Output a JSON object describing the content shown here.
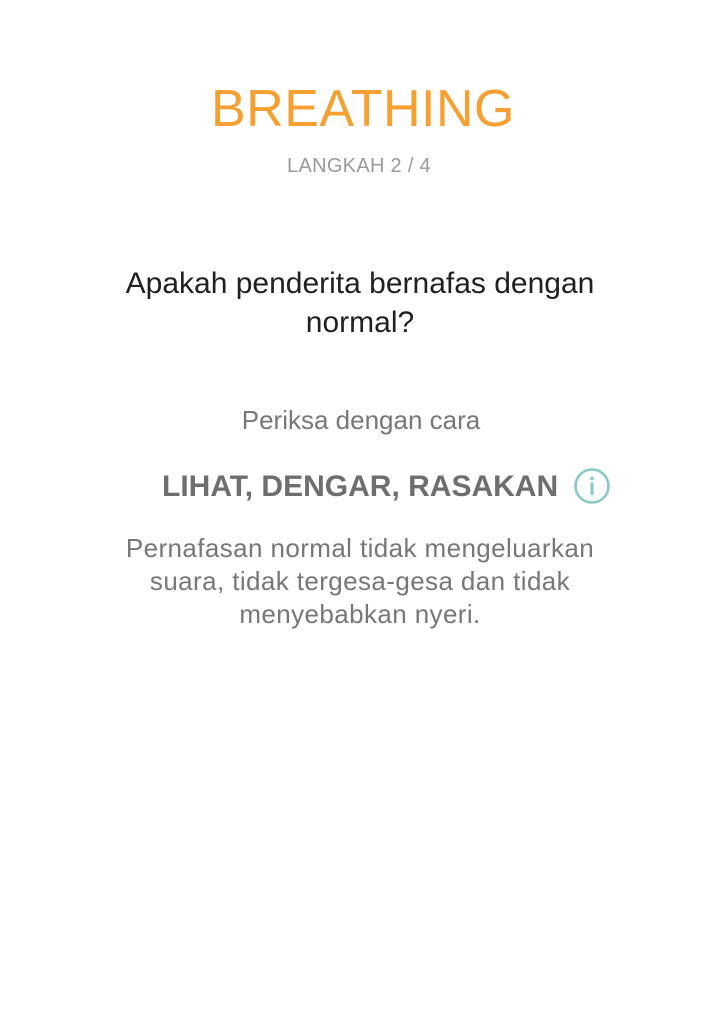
{
  "header": {
    "title": "BREATHING",
    "step_label": "LANGKAH 2 / 4"
  },
  "question": {
    "text": "Apakah penderita bernafas dengan normal?"
  },
  "instructions": {
    "intro": "Periksa dengan cara",
    "method": "LIHAT, DENGAR, RASAKAN",
    "info_icon": "info-icon",
    "description": "Pernafasan normal tidak mengeluarkan suara, tidak tergesa-gesa dan tidak menyebabkan nyeri."
  },
  "colors": {
    "accent": "#F5A030",
    "info_icon": "#8CC9C3",
    "muted_text": "#777777",
    "primary_text": "#202020",
    "background": "#FFFFFF"
  }
}
